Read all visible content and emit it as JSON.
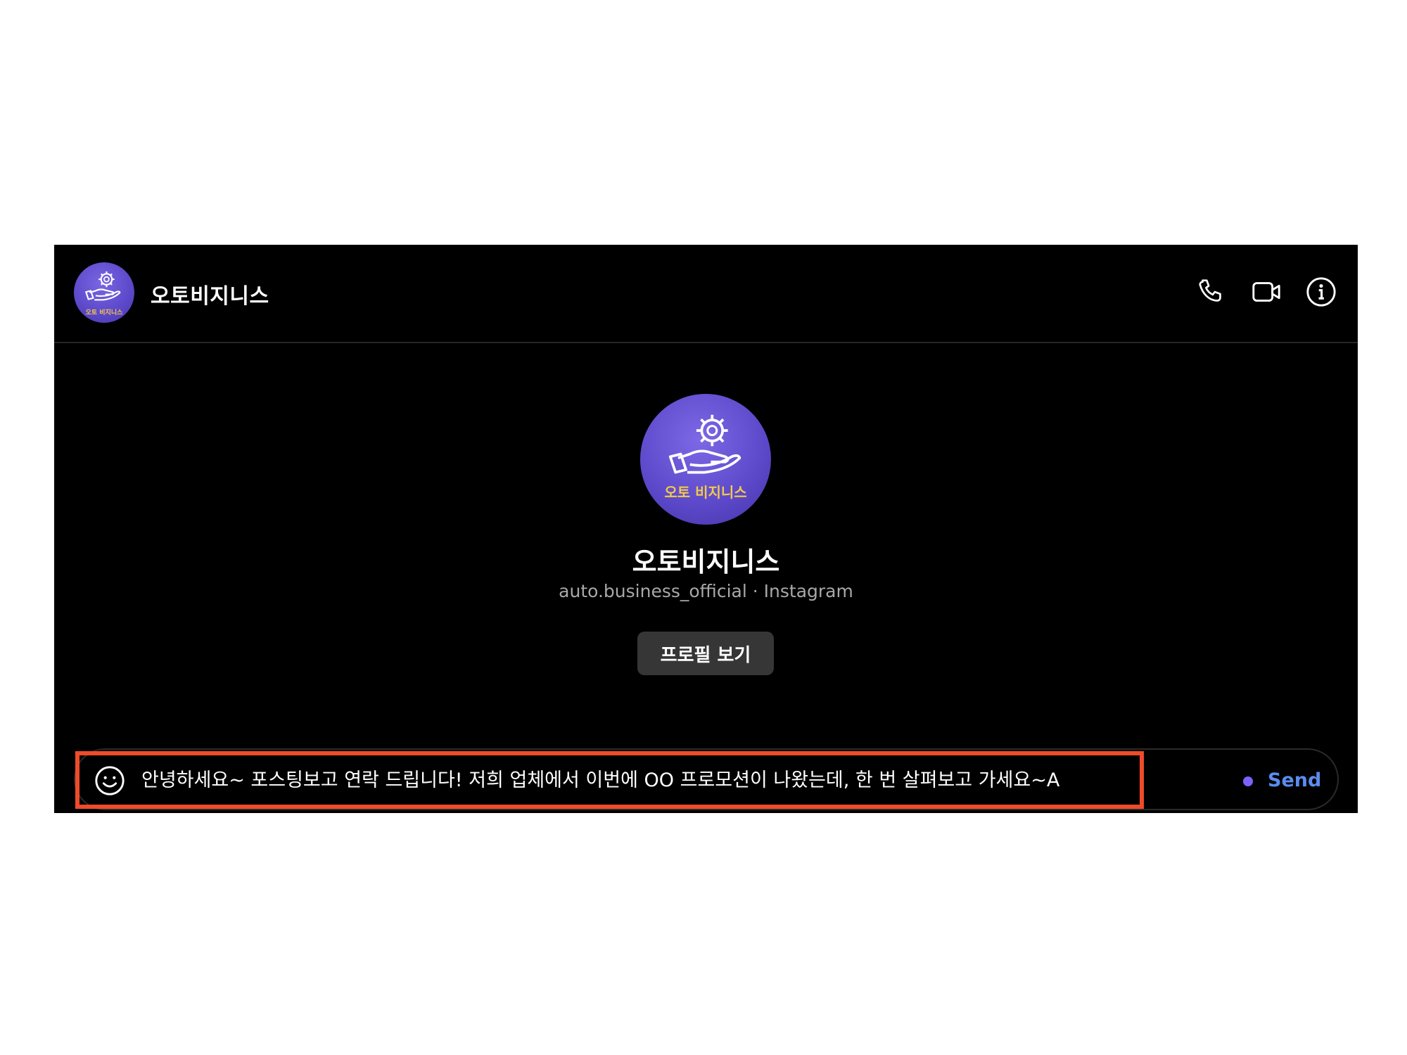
{
  "header": {
    "title": "오토비지니스",
    "avatar_icon": "gear-hand-logo-icon",
    "icons": [
      "phone-icon",
      "video-camera-icon",
      "info-icon"
    ]
  },
  "profile": {
    "logo_text": "오토 비지니스",
    "name": "오토비지니스",
    "subtitle": "auto.business_official · Instagram",
    "view_profile_label": "프로필 보기"
  },
  "composer": {
    "message_text": "안녕하세요~ 포스팅보고 연락 드립니다! 저희 업체에서 이번에 OO 프로모션이 나왔는데, 한 번 살펴보고 가세요~A",
    "send_label": "Send",
    "emoji_icon": "smiley-icon"
  },
  "colors": {
    "background": "#000000",
    "avatar": "#5b48c9",
    "logo_text": "#f2c94c",
    "send": "#5a8dee",
    "highlight": "#ee4b2b",
    "button_bg": "#363636"
  }
}
